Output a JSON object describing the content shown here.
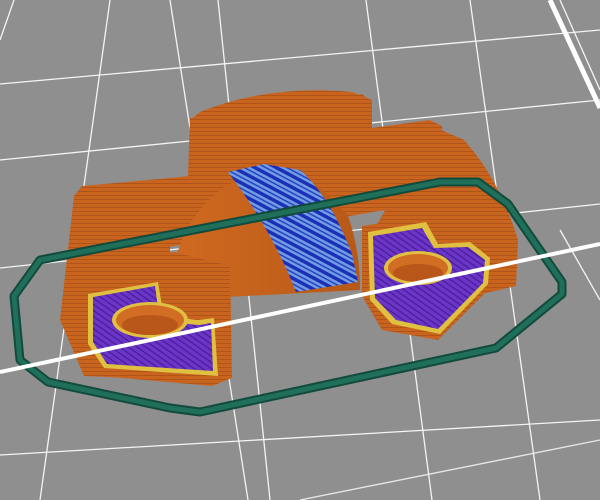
{
  "viewport": {
    "background": "#8f8f8f",
    "grid_color": "#ffffff"
  },
  "colors": {
    "perimeter": "#c9641f",
    "perimeter_dark": "#9c4a14",
    "infill": "#6b35c8",
    "infill_stripe": "#4b1f9a",
    "support": "#2c40c8",
    "support_light": "#6e9de0",
    "skirt": "#1f6f5a",
    "outline": "#e0c040"
  },
  "icons": {
    "model": "sliced-model-icon",
    "skirt": "skirt-loop-icon"
  }
}
